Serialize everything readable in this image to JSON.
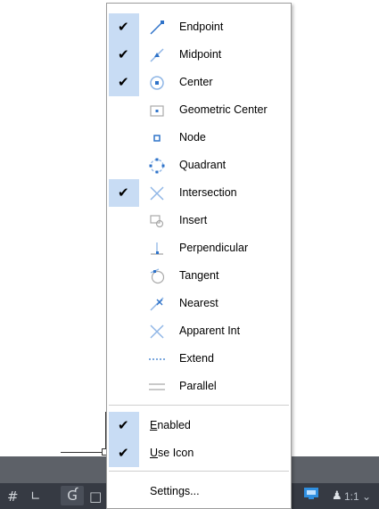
{
  "status_bar": {
    "scale_label": "1:1",
    "icons": [
      "grid-icon",
      "ortho-icon",
      "polar-icon",
      "osnap-icon",
      "workspace-icon",
      "annotation-icon"
    ]
  },
  "menu": {
    "snap_items": [
      {
        "label": "Endpoint",
        "checked": true,
        "icon": "endpoint-icon"
      },
      {
        "label": "Midpoint",
        "checked": true,
        "icon": "midpoint-icon"
      },
      {
        "label": "Center",
        "checked": true,
        "icon": "center-icon"
      },
      {
        "label": "Geometric Center",
        "checked": false,
        "icon": "geometric-center-icon"
      },
      {
        "label": "Node",
        "checked": false,
        "icon": "node-icon"
      },
      {
        "label": "Quadrant",
        "checked": false,
        "icon": "quadrant-icon"
      },
      {
        "label": "Intersection",
        "checked": true,
        "icon": "intersection-icon"
      },
      {
        "label": "Insert",
        "checked": false,
        "icon": "insert-icon"
      },
      {
        "label": "Perpendicular",
        "checked": false,
        "icon": "perpendicular-icon"
      },
      {
        "label": "Tangent",
        "checked": false,
        "icon": "tangent-icon"
      },
      {
        "label": "Nearest",
        "checked": false,
        "icon": "nearest-icon"
      },
      {
        "label": "Apparent Int",
        "checked": false,
        "icon": "apparent-int-icon"
      },
      {
        "label": "Extend",
        "checked": false,
        "icon": "extend-icon"
      },
      {
        "label": "Parallel",
        "checked": false,
        "icon": "parallel-icon"
      }
    ],
    "enabled": {
      "mnemonic": "E",
      "rest": "nabled",
      "checked": true
    },
    "use_icon": {
      "mnemonic": "U",
      "rest": "se Icon",
      "checked": true
    },
    "settings_label": "Settings..."
  },
  "colors": {
    "check_highlight": "#c8dcf4",
    "icon_blue": "#2f73c9",
    "icon_gray": "#a9a9a9",
    "status_bar": "#363a43",
    "command_band": "#5d6168"
  }
}
